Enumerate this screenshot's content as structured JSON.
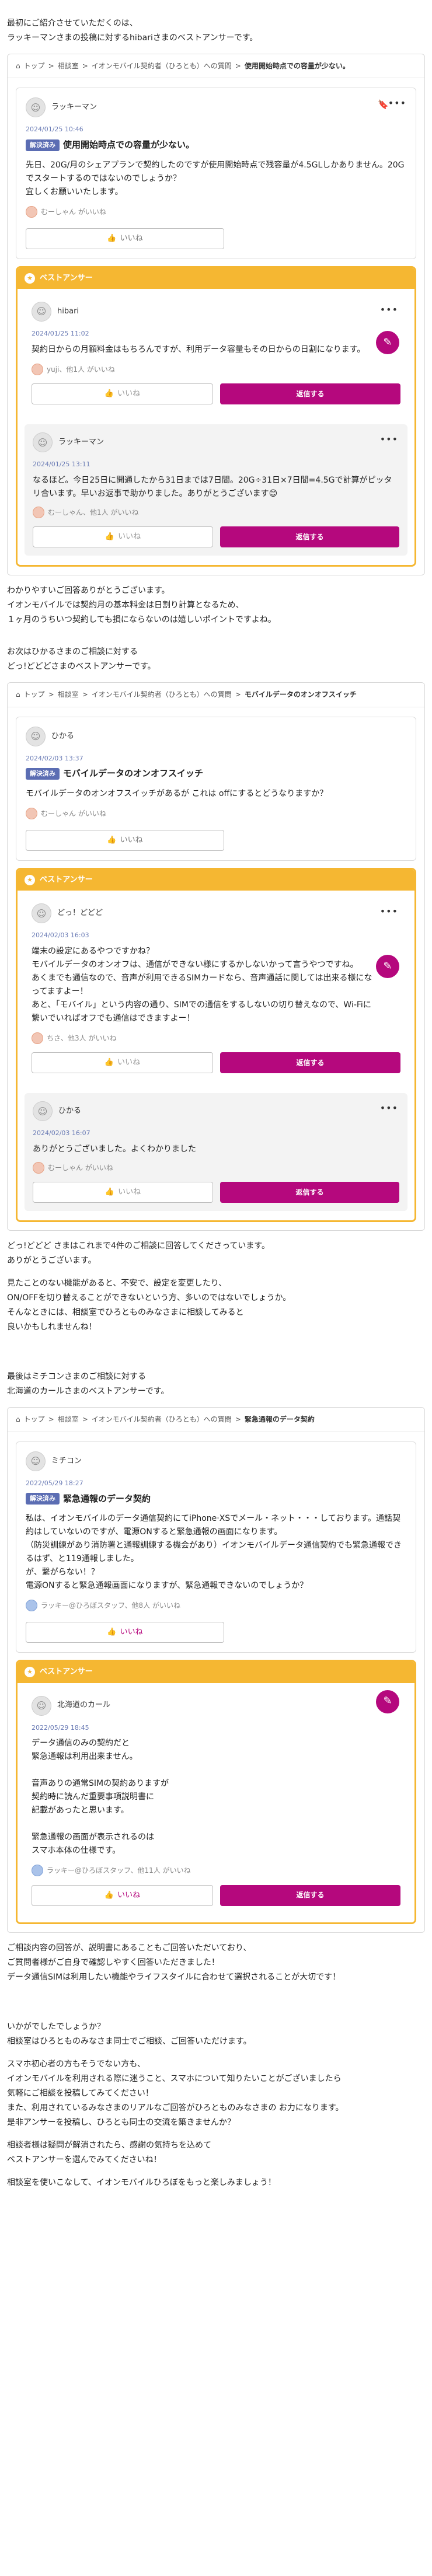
{
  "s1": {
    "intro": [
      "最初にご紹介させていただくのは、",
      "ラッキーマンさまの投稿に対するhibariさまのベストアンサーです。"
    ],
    "crumb": [
      "トップ",
      ">",
      "相談室",
      ">",
      "イオンモバイル契約者（ひろとも）への質問",
      ">",
      "使用開始時点での容量が少ない。"
    ],
    "q": {
      "user": "ラッキーマン",
      "date": "2024/01/25 10:46",
      "badge": "解決済み",
      "title": "使用開始時点での容量が少ない。",
      "text": "先日、20G/月のシェアプランで契約したのですが使用開始時点で残容量が4.5GLしかありません。20Gでスタートするのではないのでしょうか？\n宜しくお願いいたします。",
      "likes": "むーしゃん がいいね",
      "like_btn": "いいね"
    },
    "best_label": "ベストアンサー",
    "a": {
      "user": "hibari",
      "date": "2024/01/25 11:02",
      "text": "契約日からの月額料金はもちろんですが、利用データ容量もその日からの日割になります。",
      "likes": "yuji、他1人 がいいね",
      "like_btn": "いいね",
      "reply_btn": "返信する"
    },
    "r": {
      "user": "ラッキーマン",
      "date": "2024/01/25 13:11",
      "text": "なるほど。今日25日に開通したから31日までは7日間。20G÷31日×7日間=4.5Gで計算がピッタリ合います。早いお返事で助かりました。ありがとうございます😊",
      "likes": "むーしゃん、他1人 がいいね",
      "like_btn": "いいね",
      "reply_btn": "返信する"
    },
    "after": [
      "わかりやすいご回答ありがとうございます。",
      "イオンモバイルでは契約月の基本料金は日割り計算となるため、",
      "１ヶ月のうちいつ契約しても損にならないのは嬉しいポイントですよね。"
    ]
  },
  "s2": {
    "intro": [
      "お次はひかるさまのご相談に対する",
      "どっ!どどどさまのベストアンサーです。"
    ],
    "crumb": [
      "トップ",
      ">",
      "相談室",
      ">",
      "イオンモバイル契約者（ひろとも）への質問",
      ">",
      "モバイルデータのオンオフスイッチ"
    ],
    "q": {
      "user": "ひかる",
      "date": "2024/02/03 13:37",
      "badge": "解決済み",
      "title": "モバイルデータのオンオフスイッチ",
      "text": "モバイルデータのオンオフスイッチがあるが これは offにするとどうなりますか？",
      "likes": "むーしゃん がいいね",
      "like_btn": "いいね"
    },
    "best_label": "ベストアンサー",
    "a": {
      "user": "どっ！どどど",
      "date": "2024/02/03 16:03",
      "text": "端末の設定にあるやつですかね？\nモバイルデータのオンオフは、通信ができない様にするかしないかって言うやつですね。\nあくまでも通信なので、音声が利用できるSIMカードなら、音声通話に関しては出来る様になってますよー！\nあと、「モバイル」という内容の通り、SIMでの通信をするしないの切り替えなので、Wi-Fiに繋いでいればオフでも通信はできますよー！",
      "likes": "ちさ、他3人 がいいね",
      "like_btn": "いいね",
      "reply_btn": "返信する"
    },
    "r": {
      "user": "ひかる",
      "date": "2024/02/03 16:07",
      "text": "ありがとうございました。よくわかりました",
      "likes": "むーしゃん がいいね",
      "like_btn": "いいね",
      "reply_btn": "返信する"
    },
    "after": [
      "どっ!どどど さまはこれまで4件のご相談に回答してくださっています。",
      "ありがとうございます。",
      "",
      "見たことのない機能があると、不安で、設定を変更したり、",
      "ON/OFFを切り替えることができないという方、多いのではないでしょうか。",
      "そんなときには、相談室でひろとものみなさまに相談してみると",
      "良いかもしれませんね！"
    ]
  },
  "s3": {
    "intro": [
      "最後はミチコンさまのご相談に対する",
      "北海道のカールさまのベストアンサーです。"
    ],
    "crumb": [
      "トップ",
      ">",
      "相談室",
      ">",
      "イオンモバイル契約者（ひろとも）への質問",
      ">",
      "緊急通報のデータ契約"
    ],
    "q": {
      "user": "ミチコン",
      "date": "2022/05/29 18:27",
      "badge": "解決済み",
      "title": "緊急通報のデータ契約",
      "text": "私は、イオンモバイルのデータ通信契約にてiPhone·XSでメール・ネット・・・しております。通話契約はしていないのですが、電源ONすると緊急通報の画面になります。\n（防災訓練があり消防署と通報訓練する機会があり）イオンモバイルデータ通信契約でも緊急通報できるはず、と119通報しました。\nが、繋がらない！？\n電源ONすると緊急通報画面になりますが、緊急通報できないのでしょうか？",
      "likes": "ラッキー@ひろぼスタッフ、他8人 がいいね",
      "like_btn": "いいね"
    },
    "best_label": "ベストアンサー",
    "a": {
      "user": "北海道のカール",
      "date": "2022/05/29 18:45",
      "text": "データ通信のみの契約だと\n緊急通報は利用出来ません。\n\n音声ありの通常SIMの契約ありますが\n契約時に読んだ重要事項説明書に\n記載があったと思います。\n\n緊急通報の画面が表示されるのは\nスマホ本体の仕様です。",
      "likes": "ラッキー@ひろぼスタッフ、他11人 がいいね",
      "like_btn": "いいね",
      "reply_btn": "返信する"
    },
    "after": [
      "ご相談内容の回答が、説明書にあることもご回答いただいており、",
      "ご質問者様がご自身で確認しやすく回答いただきました！",
      "データ通信SIMは利用したい機能やライフスタイルに合わせて選択されることが大切です！",
      "",
      "",
      "いかがでしたでしょうか？",
      "相談室はひろとものみなさま同士でご相談、ご回答いただけます。",
      "",
      "スマホ初心者の方もそうでない方も、",
      "イオンモバイルを利用される際に迷うこと、スマホについて知りたいことがございましたら",
      "気軽にご相談を投稿してみてください！",
      "また、利用されているみなさまのリアルなご回答がひろとものみなさまの お力になります。",
      "是非アンサーを投稿し、ひろとも同士の交流を築きませんか？",
      "",
      "相談者様は疑問が解消されたら、感謝の気持ちを込めて",
      "ベストアンサーを選んでみてくださいね！",
      "",
      "相談室を使いこなして、イオンモバイルひろぼをもっと楽しみましょう！"
    ]
  }
}
